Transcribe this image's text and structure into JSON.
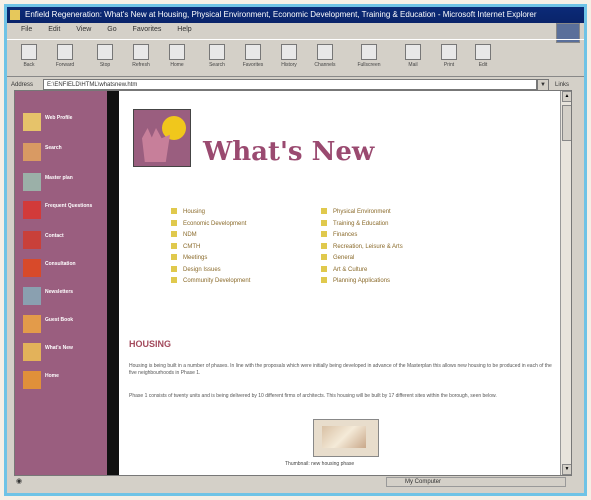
{
  "window": {
    "title": "Enfield Regeneration: What's New at Housing, Physical Environment, Economic Development, Training & Education - Microsoft Internet Explorer"
  },
  "menu": [
    "File",
    "Edit",
    "View",
    "Go",
    "Favorites",
    "Help"
  ],
  "toolbar": [
    "Back",
    "Forward",
    "Stop",
    "Refresh",
    "Home",
    "Search",
    "Favorites",
    "History",
    "Channels",
    "Fullscreen",
    "Mail",
    "Print",
    "Edit"
  ],
  "address": {
    "label": "Address",
    "value": "E:\\ENFIELD\\HTML\\whatsnew.htm",
    "links_label": "Links"
  },
  "sidebar": {
    "items": [
      {
        "label": "Web Profile"
      },
      {
        "label": "Search"
      },
      {
        "label": "Master plan"
      },
      {
        "label": "Frequent Questions"
      },
      {
        "label": "Contact"
      },
      {
        "label": "Consultation"
      },
      {
        "label": "Newsletters"
      },
      {
        "label": "Guest Book"
      },
      {
        "label": "What's New"
      },
      {
        "label": "Home"
      }
    ]
  },
  "page": {
    "title": "What's New",
    "left_links": [
      "Housing",
      "Economic Development",
      "NDM",
      "CMTH",
      "Meetings",
      "Design Issues",
      "Community Development"
    ],
    "right_links": [
      "Physical Environment",
      "Training & Education",
      "Finances",
      "Recreation, Leisure & Arts",
      "General",
      "Art & Culture",
      "Planning Applications"
    ],
    "section_heading": "HOUSING",
    "para1": "Housing is being built in a number of phases. In line with the proposals which were initially being developed in advance of the Masterplan this allows new housing to be produced in each of the five neighbourhoods in Phase 1.",
    "para2": "Phase 1 consists of twenty units and is being delivered by 10 different firms of architects. This housing will be built by 17 different sites within the borough, seen below.",
    "image_caption": "Thumbnail: new housing phase"
  },
  "status": {
    "zone": "My Computer"
  }
}
